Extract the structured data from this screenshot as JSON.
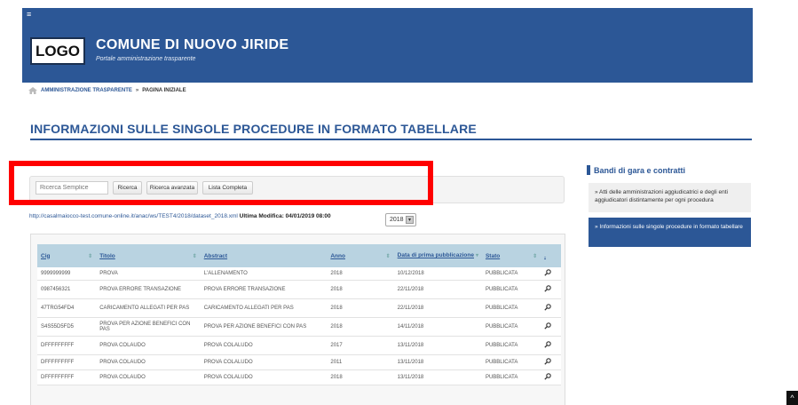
{
  "header": {
    "menu_icon": "hamburger-icon",
    "logo_text": "LOGO",
    "title": "COMUNE DI NUOVO JIRIDE",
    "subtitle": "Portale amministrazione trasparente",
    "color": "#2c5796"
  },
  "breadcrumb": {
    "home_icon": "home-icon",
    "link": "AMMINISTRAZIONE TRASPARENTE",
    "separator": "»",
    "current": "PAGINA INIZIALE"
  },
  "page": {
    "title": "INFORMAZIONI SULLE SINGOLE PROCEDURE IN FORMATO TABELLARE"
  },
  "search": {
    "placeholder": "Ricerca Semplice",
    "buttons": [
      "Ricerca",
      "Ricerca avanzata",
      "Lista Completa"
    ]
  },
  "dataset": {
    "url": "http://casalmaiocco-test.comune-online.it/anac/ws/TEST4/2018/dataset_2018.xml",
    "modified_label": "Ultima Modifica: 04/01/2019 08:00",
    "year": "2018"
  },
  "table": {
    "columns": [
      "Cig",
      "Titolo",
      "Abstract",
      "Anno",
      "Data di prima pubblicazione",
      "Stato",
      "."
    ],
    "rows": [
      [
        "9999999999",
        "PROVA",
        "L'ALLENAMENTO",
        "2018",
        "10/12/2018",
        "PUBBLICATA"
      ],
      [
        "0987456321",
        "PROVA ERRORE TRANSAZIONE",
        "PROVA ERRORE TRANSAZIONE",
        "2018",
        "22/11/2018",
        "PUBBLICATA"
      ],
      [
        "47TRG54FD4",
        "CARICAMENTO ALLEGATI PER PAS",
        "CARICAMENTO ALLEGATI PER PAS",
        "2018",
        "22/11/2018",
        "PUBBLICATA"
      ],
      [
        "S4S55D5FD5",
        "PROVA PER AZIONE BENEFICI CON PAS",
        "PROVA PER AZIONE BENEFICI CON PAS",
        "2018",
        "14/11/2018",
        "PUBBLICATA"
      ],
      [
        "DFFFFFFFFF",
        "PROVA COLAUDO",
        "PROVA COLALUDO",
        "2017",
        "13/11/2018",
        "PUBBLICATA"
      ],
      [
        "DFFFFFFFFF",
        "PROVA COLAUDO",
        "PROVA COLALUDO",
        "2011",
        "13/11/2018",
        "PUBBLICATA"
      ],
      [
        "DFFFFFFFFF",
        "PROVA COLAUDO",
        "PROVA COLALUDO",
        "2018",
        "13/11/2018",
        "PUBBLICATA"
      ]
    ],
    "row_action_icon": "search-icon"
  },
  "sidebar": {
    "title": "Bandi di gara e contratti",
    "items": [
      "» Atti delle amministrazioni aggiudicatrici e degli enti aggiudicatori distintamente per ogni procedura",
      "» Informazioni sulle singole procedure in formato tabellare"
    ]
  },
  "scroll_top_icon": "chevron-up-icon"
}
